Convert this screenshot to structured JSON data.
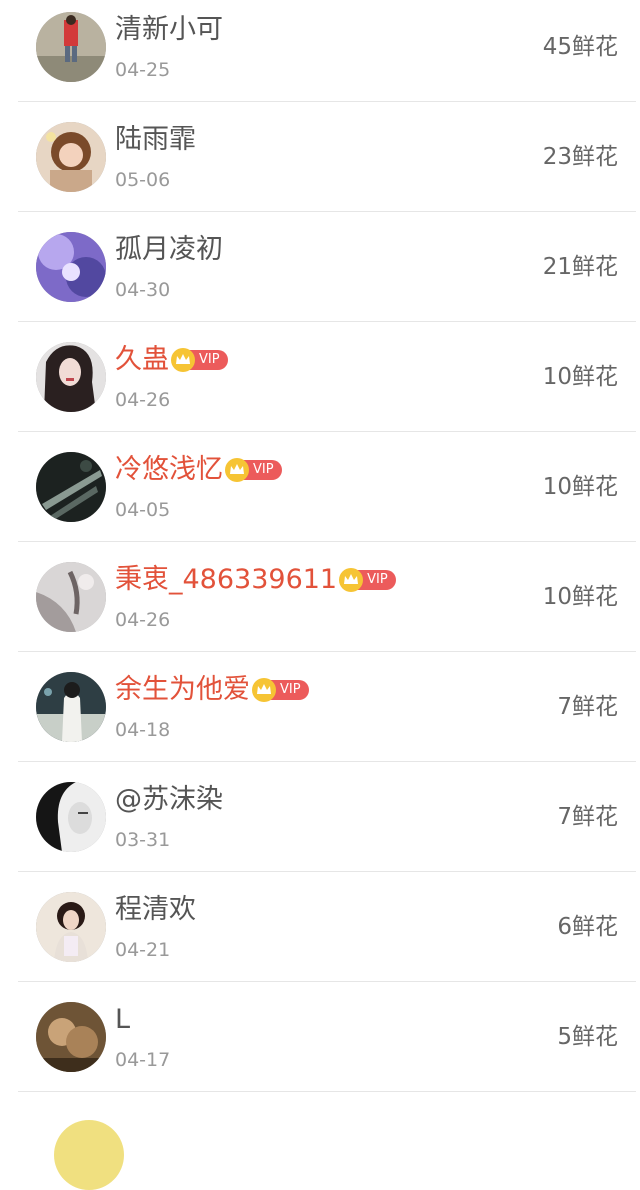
{
  "gifts": {
    "unit": "鲜花",
    "vip_badge_text": "VIP",
    "rows": [
      {
        "name": "清新小可",
        "date": "04-25",
        "flowers": "45鲜花",
        "vip": false
      },
      {
        "name": "陆雨霏",
        "date": "05-06",
        "flowers": "23鲜花",
        "vip": false
      },
      {
        "name": "孤月凌初",
        "date": "04-30",
        "flowers": "21鲜花",
        "vip": false
      },
      {
        "name": "久蛊",
        "date": "04-26",
        "flowers": "10鲜花",
        "vip": true
      },
      {
        "name": "冷悠浅忆",
        "date": "04-05",
        "flowers": "10鲜花",
        "vip": true
      },
      {
        "name": "秉衷_486339611",
        "date": "04-26",
        "flowers": "10鲜花",
        "vip": true
      },
      {
        "name": "余生为他爱",
        "date": "04-18",
        "flowers": "7鲜花",
        "vip": true
      },
      {
        "name": "@苏沫染",
        "date": "03-31",
        "flowers": "7鲜花",
        "vip": false
      },
      {
        "name": "程清欢",
        "date": "04-21",
        "flowers": "6鲜花",
        "vip": false
      },
      {
        "name": "L",
        "date": "04-17",
        "flowers": "5鲜花",
        "vip": false
      }
    ]
  },
  "colors": {
    "vip_name": "#e2523a",
    "normal_name": "#555555",
    "date": "#999999",
    "vip_badge": "#ec5b5b",
    "divider": "#e6e6e6"
  }
}
